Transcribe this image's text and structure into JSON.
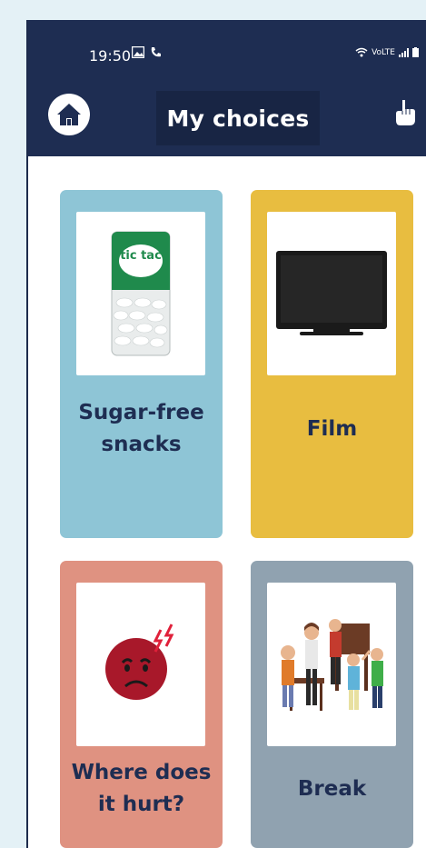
{
  "status_bar": {
    "time": "19:50",
    "network": "VoLTE"
  },
  "header": {
    "title": "My choices",
    "home_icon": "home-icon",
    "hand_icon": "pointing-hand-icon"
  },
  "cards": [
    {
      "label_line1": "Sugar-free",
      "label_line2": "snacks",
      "icon": "tic-tac-icon",
      "color": "#8ec5d6"
    },
    {
      "label_line1": "Film",
      "label_line2": "",
      "icon": "television-icon",
      "color": "#e8bd40"
    },
    {
      "label_line1": "Where does",
      "label_line2": "it hurt?",
      "icon": "pain-face-icon",
      "color": "#df9281"
    },
    {
      "label_line1": "Break",
      "label_line2": "",
      "icon": "children-playing-icon",
      "color": "#90a2b0"
    }
  ],
  "tic_tac_brand": "tic tac",
  "colors": {
    "header": "#1e2d52",
    "background": "#e4f1f6",
    "label_text": "#1e2d52"
  }
}
